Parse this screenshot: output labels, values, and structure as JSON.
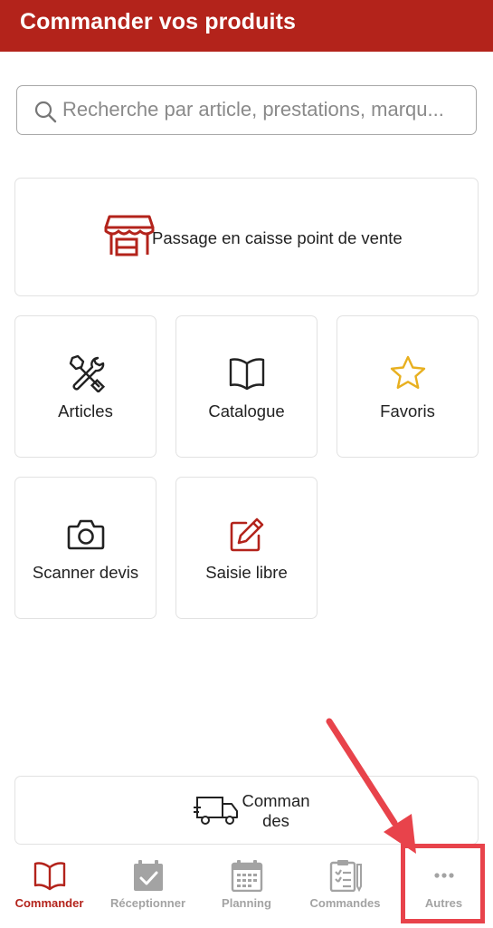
{
  "header": {
    "title": "Commander vos produits"
  },
  "search": {
    "placeholder": "Recherche par article, prestations, marqu..."
  },
  "pos_card": {
    "label": "Passage en caisse point de vente",
    "icon": "store-icon"
  },
  "tiles": [
    {
      "label": "Articles",
      "icon": "tools-icon"
    },
    {
      "label": "Catalogue",
      "icon": "book-icon"
    },
    {
      "label": "Favoris",
      "icon": "star-icon"
    },
    {
      "label": "Scanner devis",
      "icon": "camera-icon"
    },
    {
      "label": "Saisie libre",
      "icon": "edit-icon"
    }
  ],
  "orders_card": {
    "label": "Commandes",
    "icon": "truck-icon"
  },
  "tabs": [
    {
      "label": "Commander",
      "icon": "book-icon",
      "active": true
    },
    {
      "label": "Réceptionner",
      "icon": "calendar-check-icon",
      "active": false
    },
    {
      "label": "Planning",
      "icon": "calendar-icon",
      "active": false
    },
    {
      "label": "Commandes",
      "icon": "clipboard-icon",
      "active": false
    },
    {
      "label": "Autres",
      "icon": "more-icon",
      "active": false
    }
  ],
  "colors": {
    "brand": "#b3231b",
    "annotation": "#e8434b",
    "star": "#e8b020",
    "tab_inactive": "#a3a3a3"
  }
}
